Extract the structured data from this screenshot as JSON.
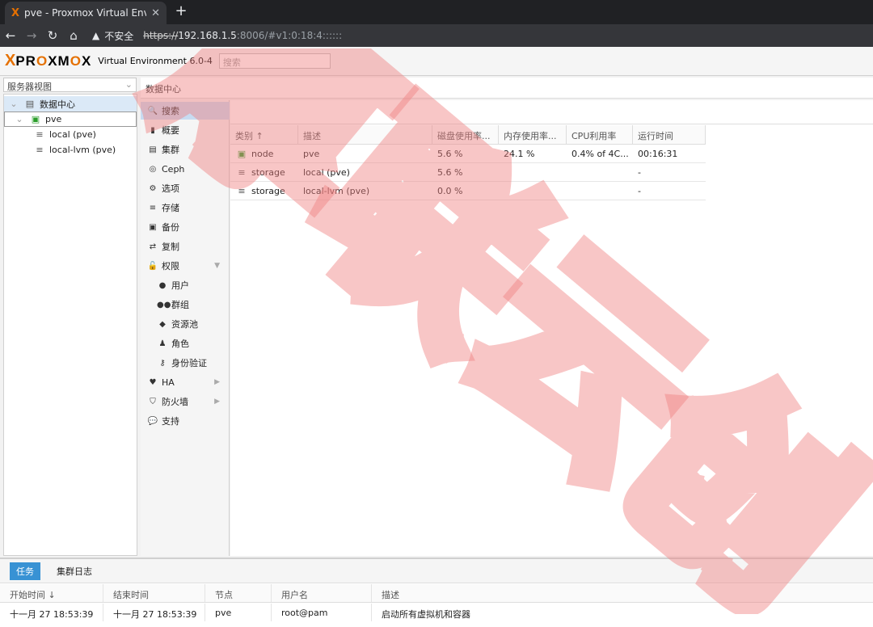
{
  "browser": {
    "tab_title": "pve - Proxmox Virtual Environm",
    "tab_logo": "X",
    "close": "✕",
    "new_tab": "+",
    "security_label": "不安全",
    "url_scheme": "https://",
    "url_host": "192.168.1.5",
    "url_rest": ":8006/#v1:0:18:4::::::"
  },
  "header": {
    "logo_x": "X",
    "logo_p": "PR",
    "logo_o1": "O",
    "logo_mid": "XM",
    "logo_o2": "O",
    "logo_end": "X",
    "version": "Virtual Environment 6.0-4",
    "search_placeholder": "搜索"
  },
  "tree": {
    "view_selector": "服务器视图",
    "datacenter": "数据中心",
    "node": "pve",
    "storage_1": "local (pve)",
    "storage_2": "local-lvm (pve)"
  },
  "breadcrumb": "数据中心",
  "menu": [
    {
      "label": "搜索",
      "icon": "search-icon",
      "glyph": "🔍"
    },
    {
      "label": "概要",
      "icon": "book-icon",
      "glyph": "▮"
    },
    {
      "label": "集群",
      "icon": "server-icon",
      "glyph": "▤"
    },
    {
      "label": "Ceph",
      "icon": "ceph-icon",
      "glyph": "◎"
    },
    {
      "label": "选项",
      "icon": "gear-icon",
      "glyph": "⚙"
    },
    {
      "label": "存储",
      "icon": "database-icon",
      "glyph": "≡"
    },
    {
      "label": "备份",
      "icon": "floppy-icon",
      "glyph": "▣"
    },
    {
      "label": "复制",
      "icon": "retweet-icon",
      "glyph": "⇄"
    },
    {
      "label": "权限",
      "icon": "unlock-icon",
      "glyph": "🔓"
    },
    {
      "label": "用户",
      "icon": "user-icon",
      "glyph": "●"
    },
    {
      "label": "群组",
      "icon": "users-icon",
      "glyph": "●●"
    },
    {
      "label": "资源池",
      "icon": "tags-icon",
      "glyph": "◆"
    },
    {
      "label": "角色",
      "icon": "male-icon",
      "glyph": "♟"
    },
    {
      "label": "身份验证",
      "icon": "key-icon",
      "glyph": "⚷"
    },
    {
      "label": "HA",
      "icon": "heartbeat-icon",
      "glyph": "♥"
    },
    {
      "label": "防火墙",
      "icon": "shield-icon",
      "glyph": "⛉"
    },
    {
      "label": "支持",
      "icon": "comments-icon",
      "glyph": "💬"
    }
  ],
  "grid": {
    "columns": [
      "类别 ↑",
      "描述",
      "磁盘使用率...",
      "内存使用率...",
      "CPU利用率",
      "运行时间"
    ],
    "rows": [
      {
        "type": "node",
        "desc": "pve",
        "disk": "5.6 %",
        "mem": "24.1 %",
        "cpu": "0.4% of 4C...",
        "uptime": "00:16:31"
      },
      {
        "type": "storage",
        "desc": "local (pve)",
        "disk": "5.6 %",
        "mem": "",
        "cpu": "",
        "uptime": "-"
      },
      {
        "type": "storage",
        "desc": "local-lvm (pve)",
        "disk": "0.0 %",
        "mem": "",
        "cpu": "",
        "uptime": "-"
      }
    ]
  },
  "tasks": {
    "tab_tasks": "任务",
    "tab_cluster_log": "集群日志",
    "columns": [
      "开始时间 ↓",
      "结束时间",
      "节点",
      "用户名",
      "描述"
    ],
    "row": {
      "start": "十一月 27 18:53:39",
      "end": "十一月 27 18:53:39",
      "node": "pve",
      "user": "root@pam",
      "desc": "启动所有虚拟机和容器"
    }
  },
  "watermark": "厚联云创",
  "colors": {
    "brand": "#e57000",
    "selected": "#c7dbf1",
    "active_tab": "#3892d4"
  }
}
